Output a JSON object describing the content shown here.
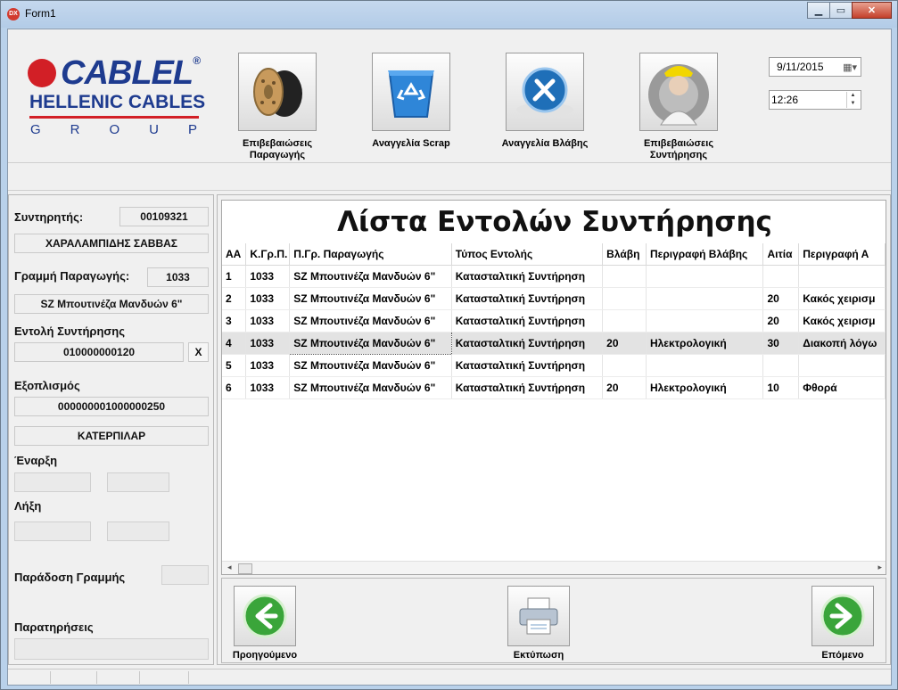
{
  "window": {
    "title": "Form1",
    "icon_text": "DX"
  },
  "logo": {
    "brand": "CABLEL",
    "registered": "®",
    "line2": "HELLENIC CABLES",
    "line3": "GROUP"
  },
  "toolbar": [
    {
      "label": "Επιβεβαιώσεις Παραγωγής",
      "icon": "cable-reel-icon"
    },
    {
      "label": "Αναγγελία Scrap",
      "icon": "recycle-bin-icon"
    },
    {
      "label": "Αναγγελία Βλάβης",
      "icon": "tools-icon"
    },
    {
      "label": "Επιβεβαιώσεις Συντήρησης",
      "icon": "technician-icon"
    }
  ],
  "datetime": {
    "date": "9/11/2015",
    "time": "12:26"
  },
  "form": {
    "maintainer_label": "Συντηρητής:",
    "maintainer_id": "00109321",
    "maintainer_name": "ΧΑΡΑΛΑΜΠΙΔΗΣ ΣΑΒΒΑΣ",
    "line_label": "Γραμμή Παραγωγής:",
    "line_id": "1033",
    "line_name": "SZ Μπουτινέζα Μανδυών 6\"",
    "order_label": "Εντολή Συντήρησης",
    "order_id": "010000000120",
    "order_clear": "X",
    "equipment_label": "Εξοπλισμός",
    "equipment_id": "000000001000000250",
    "equipment_name": "ΚΑΤΕΡΠΙΛΑΡ",
    "start_label": "Έναρξη",
    "end_label": "Λήξη",
    "handover_label": "Παράδοση Γραμμής",
    "notes_label": "Παρατηρήσεις"
  },
  "grid": {
    "title": "Λίστα Εντολών Συντήρησης",
    "columns": [
      "ΑΑ",
      "Κ.Γρ.Π.",
      "Π.Γρ. Παραγωγής",
      "Τύπος Εντολής",
      "Βλάβη",
      "Περιγραφή Βλάβης",
      "Αιτία",
      "Περιγραφή Α"
    ],
    "rows": [
      [
        "1",
        "1033",
        "SZ Μπουτινέζα Μανδυών 6\"",
        "Κατασταλτική Συντήρηση",
        "",
        "",
        "",
        ""
      ],
      [
        "2",
        "1033",
        "SZ Μπουτινέζα Μανδυών 6\"",
        "Κατασταλτική Συντήρηση",
        "",
        "",
        "20",
        "Κακός χειρισμ"
      ],
      [
        "3",
        "1033",
        "SZ Μπουτινέζα Μανδυών 6\"",
        "Κατασταλτική Συντήρηση",
        "",
        "",
        "20",
        "Κακός χειρισμ"
      ],
      [
        "4",
        "1033",
        "SZ Μπουτινέζα Μανδυών 6\"",
        "Κατασταλτική Συντήρηση",
        "20",
        "Ηλεκτρολογική",
        "30",
        "Διακοπή λόγω"
      ],
      [
        "5",
        "1033",
        "SZ Μπουτινέζα Μανδυών 6\"",
        "Κατασταλτική Συντήρηση",
        "",
        "",
        "",
        ""
      ],
      [
        "6",
        "1033",
        "SZ Μπουτινέζα Μανδυών 6\"",
        "Κατασταλτική Συντήρηση",
        "20",
        "Ηλεκτρολογική",
        "10",
        "Φθορά"
      ]
    ],
    "selected_row": 4
  },
  "nav": {
    "prev_label": "Προηγούμενο",
    "print_label": "Εκτύπωση",
    "next_label": "Επόμενο"
  },
  "colors": {
    "brand_red": "#d21f26",
    "brand_blue": "#1e3b8f",
    "nav_green": "#3aa53a"
  }
}
